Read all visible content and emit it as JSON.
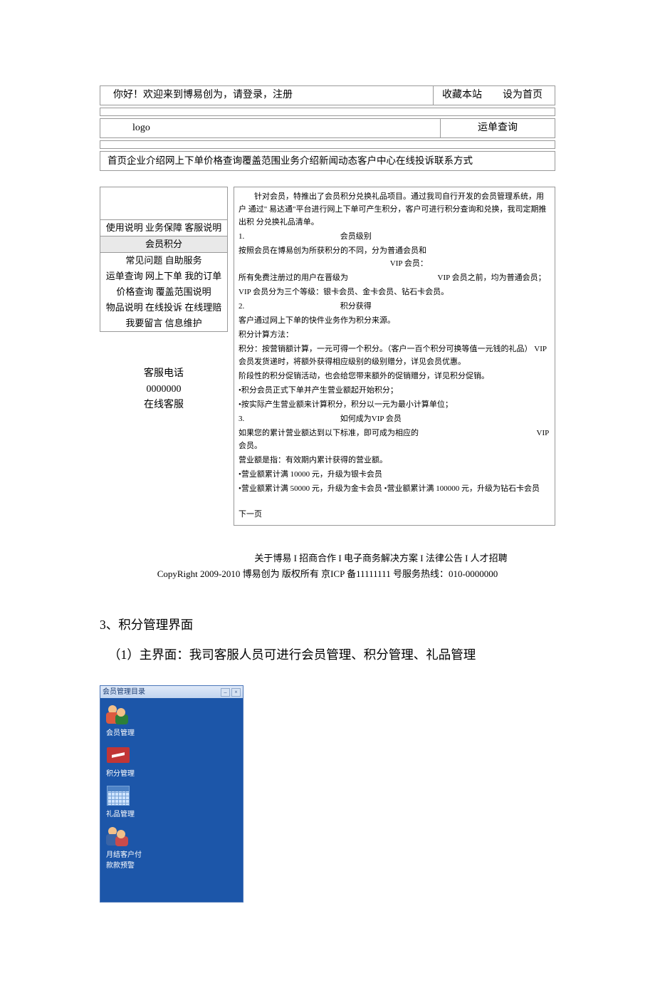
{
  "header": {
    "welcome": "你好！欢迎来到博易创为，请登录，注册",
    "bookmark": "收藏本站",
    "sethome": "设为首页",
    "logo": "logo",
    "waybill": "运单查询",
    "nav": "首页企业介绍网上下单价格查询覆盖范围业务介绍新闻动态客户中心在线投诉联系方式"
  },
  "sidebar": {
    "l1": "使用说明 业务保障 客服说明",
    "points": "会员积分",
    "l2": "常见问题 自助服务",
    "l3": "运单查询 网上下单 我的订单 价格查询 覆盖范围说明",
    "l4": "物品说明 在线投诉 在线理赔 我要留言 信息维护",
    "svc1": "客服电话",
    "svc2": "0000000",
    "svc3": "在线客服"
  },
  "article": {
    "intro": "针对会员，特推出了会员积分兑换礼品项目。通过我司自行开发的会员管理系统，用户 通过\" 易达通\"平台进行网上下单可产生积分，客户可进行积分查询和兑换，我司定期推出积 分兑换礼品清单。",
    "s1_num": "1.",
    "s1_title": "会员级别",
    "s1_l1a": "按照会员在博易创为所获积分的不同，分为普通会员和",
    "s1_l1b": "VIP 会员：",
    "s1_l2a": "所有免费注册过的用户在晋级为",
    "s1_l2b": "VIP 会员之前，均为普通会员；",
    "s1_l3": "VIP 会员分为三个等级：银卡会员、金卡会员、钻石卡会员。",
    "s2_num": "2.",
    "s2_title": "积分获得",
    "s2_l1": "客户通过网上下单的快件业务作为积分来源。",
    "s2_l2": "积分计算方法：",
    "s2_l3": "积分：按营销额计算，一元可得一个积分。（客户一百个积分可换等值一元钱的礼品） VIP 会员发货递时，将额外获得相应级别的级别赠分，详见会员优惠。",
    "s2_l4": "阶段性的积分促销活动，也会给您带来额外的促销赠分，详见积分促销。",
    "s2_b1": "•积分会员正式下单并产生营业额起开始积分；",
    "s2_b2": "•按实际产生营业额来计算积分，积分以一元为最小计算单位；",
    "s3_num": "3.",
    "s3_title": "如何成为VIP 会员",
    "s3_l1a": "如果您的累计营业额达到以下标准，即可成为相应的",
    "s3_l1b": "VIP 会员。",
    "s3_l2": "营业额是指：有效期内累计获得的营业额。",
    "s3_b1": "•营业额累计满 10000 元，升级为银卡会员",
    "s3_b2": "•营业额累计满 50000 元，升级为金卡会员  •营业额累计满 100000 元，升级为钻石卡会员",
    "next": "下一页"
  },
  "footer": {
    "links": "关于博易 I 招商合作 I 电子商务解决方案 I 法律公告 I 人才招聘",
    "copy": "CopyRight 2009-2010 博易创为 版权所有 京ICP 备11111111 号服务热线：010-0000000"
  },
  "outline": {
    "l1": "3、积分管理界面",
    "l2": "（1）主界面：我司客服人员可进行会员管理、积分管理、礼品管理"
  },
  "app": {
    "title": "会员管理目录",
    "icons": {
      "member": "会员管理",
      "points": "积分管理",
      "gift": "礼品管理",
      "monthly": "月结客户付\n款款预警"
    }
  }
}
